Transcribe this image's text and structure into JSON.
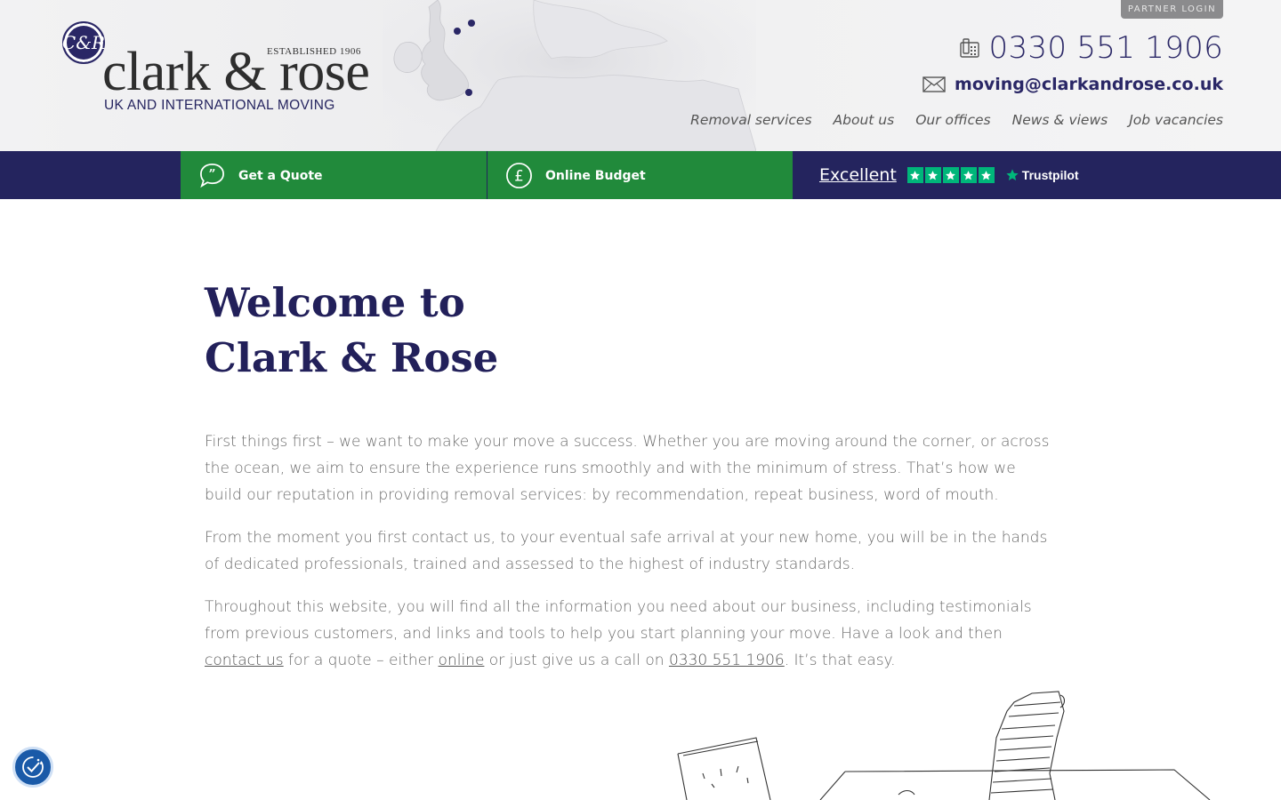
{
  "logo": {
    "established": "ESTABLISHED 1906",
    "name": "clark & rose",
    "tagline": "UK AND INTERNATIONAL MOVING",
    "seal_letters": "C&R"
  },
  "header": {
    "partner_login": "PARTNER LOGIN",
    "phone": "0330 551 1906",
    "email": "moving@clarkandrose.co.uk",
    "phone_icon": "phone-icon",
    "email_icon": "envelope-icon"
  },
  "nav": {
    "items": [
      {
        "label": "Removal services"
      },
      {
        "label": "About us"
      },
      {
        "label": "Our offices"
      },
      {
        "label": "News & views"
      },
      {
        "label": "Job vacancies"
      }
    ]
  },
  "actions": {
    "quote_label": "Get a Quote",
    "budget_label": "Online Budget",
    "quote_icon": "speech-bubble-icon",
    "budget_icon": "pound-icon"
  },
  "trustpilot": {
    "rating_text": "Excellent",
    "brand": "Trustpilot",
    "stars": 5
  },
  "main": {
    "title_line1": "Welcome to",
    "title_line2": "Clark & Rose",
    "para1": "First things first – we want to make your move a success.  Whether you are moving around the corner, or across the ocean, we aim to ensure the experience runs smoothly and with the minimum of stress. That’s how we build our reputation in providing removal services: by recommendation, repeat business, word of mouth.",
    "para2": "From the moment you first contact us, to your eventual safe arrival at your new home, you will be in the hands of dedicated professionals, trained and assessed to the highest of industry standards.",
    "para3_a": "Throughout this website, you will find all the information you need about our business, including testimonials from previous customers, and links and tools to help you start planning your move. Have a look and then ",
    "para3_link1": "contact us",
    "para3_b": " for a quote – either ",
    "para3_link2": "online",
    "para3_c": " or just give us a call on ",
    "para3_link3": "0330 551 1906",
    "para3_d": ". It’s that easy."
  },
  "colors": {
    "navy": "#24245e",
    "green": "#218a3b",
    "trustpilot_green": "#00b67a",
    "title": "#22205a"
  }
}
